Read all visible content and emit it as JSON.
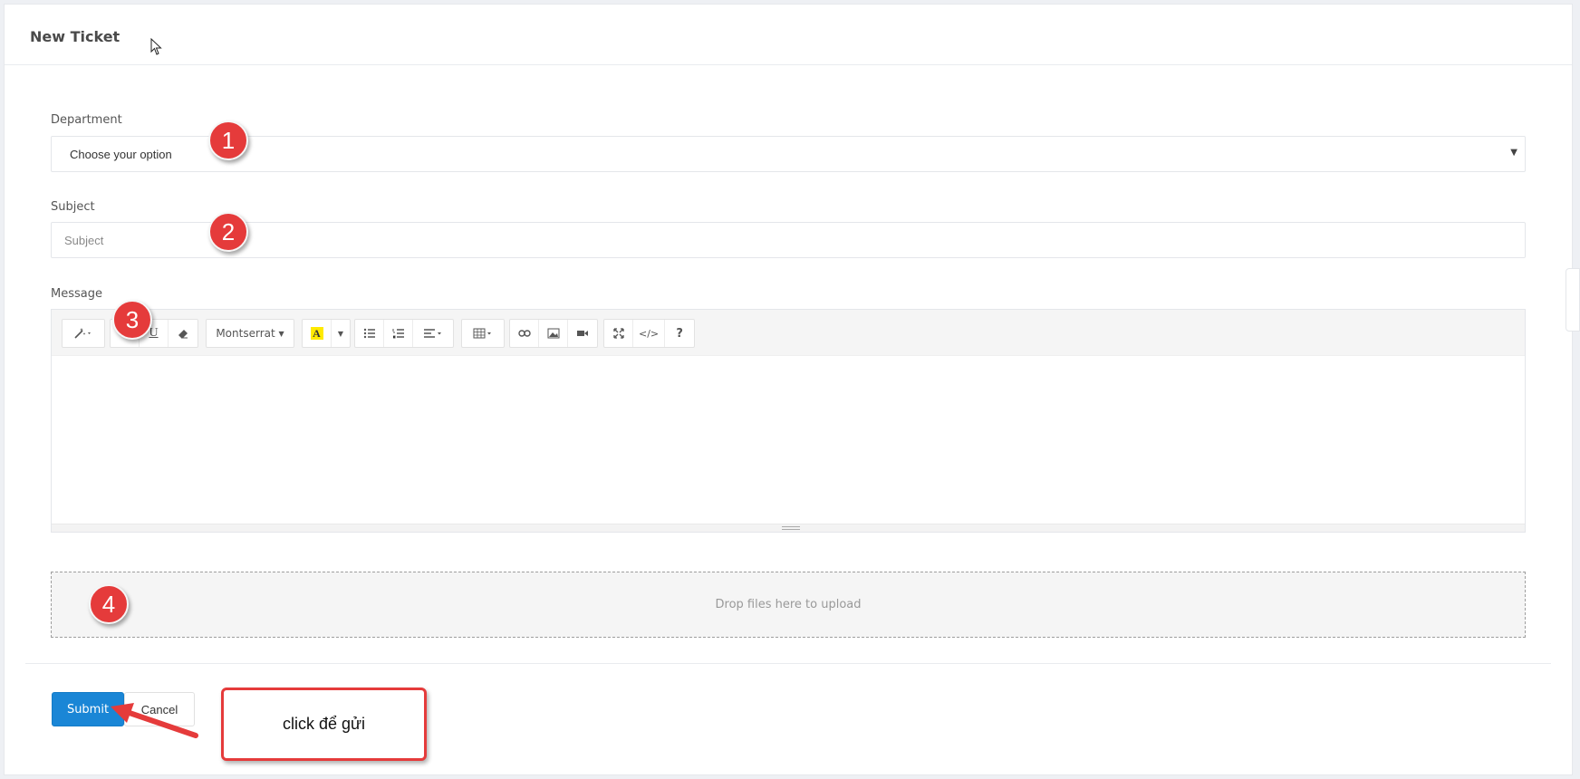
{
  "header": {
    "title": "New Ticket"
  },
  "form": {
    "department": {
      "label": "Department",
      "value": "Choose your option"
    },
    "subject": {
      "label": "Subject",
      "placeholder": "Subject"
    },
    "message": {
      "label": "Message"
    },
    "toolbar": {
      "font_name": "Montserrat",
      "help": "?"
    },
    "dropzone": {
      "text": "Drop files here to upload"
    }
  },
  "actions": {
    "submit_label": "Submit",
    "cancel_label": "Cancel"
  },
  "annotations": {
    "badges": [
      "1",
      "2",
      "3",
      "4"
    ],
    "callout": "click để gửi",
    "color": "#e53b3b"
  },
  "colors": {
    "primary": "#1a86d6"
  }
}
